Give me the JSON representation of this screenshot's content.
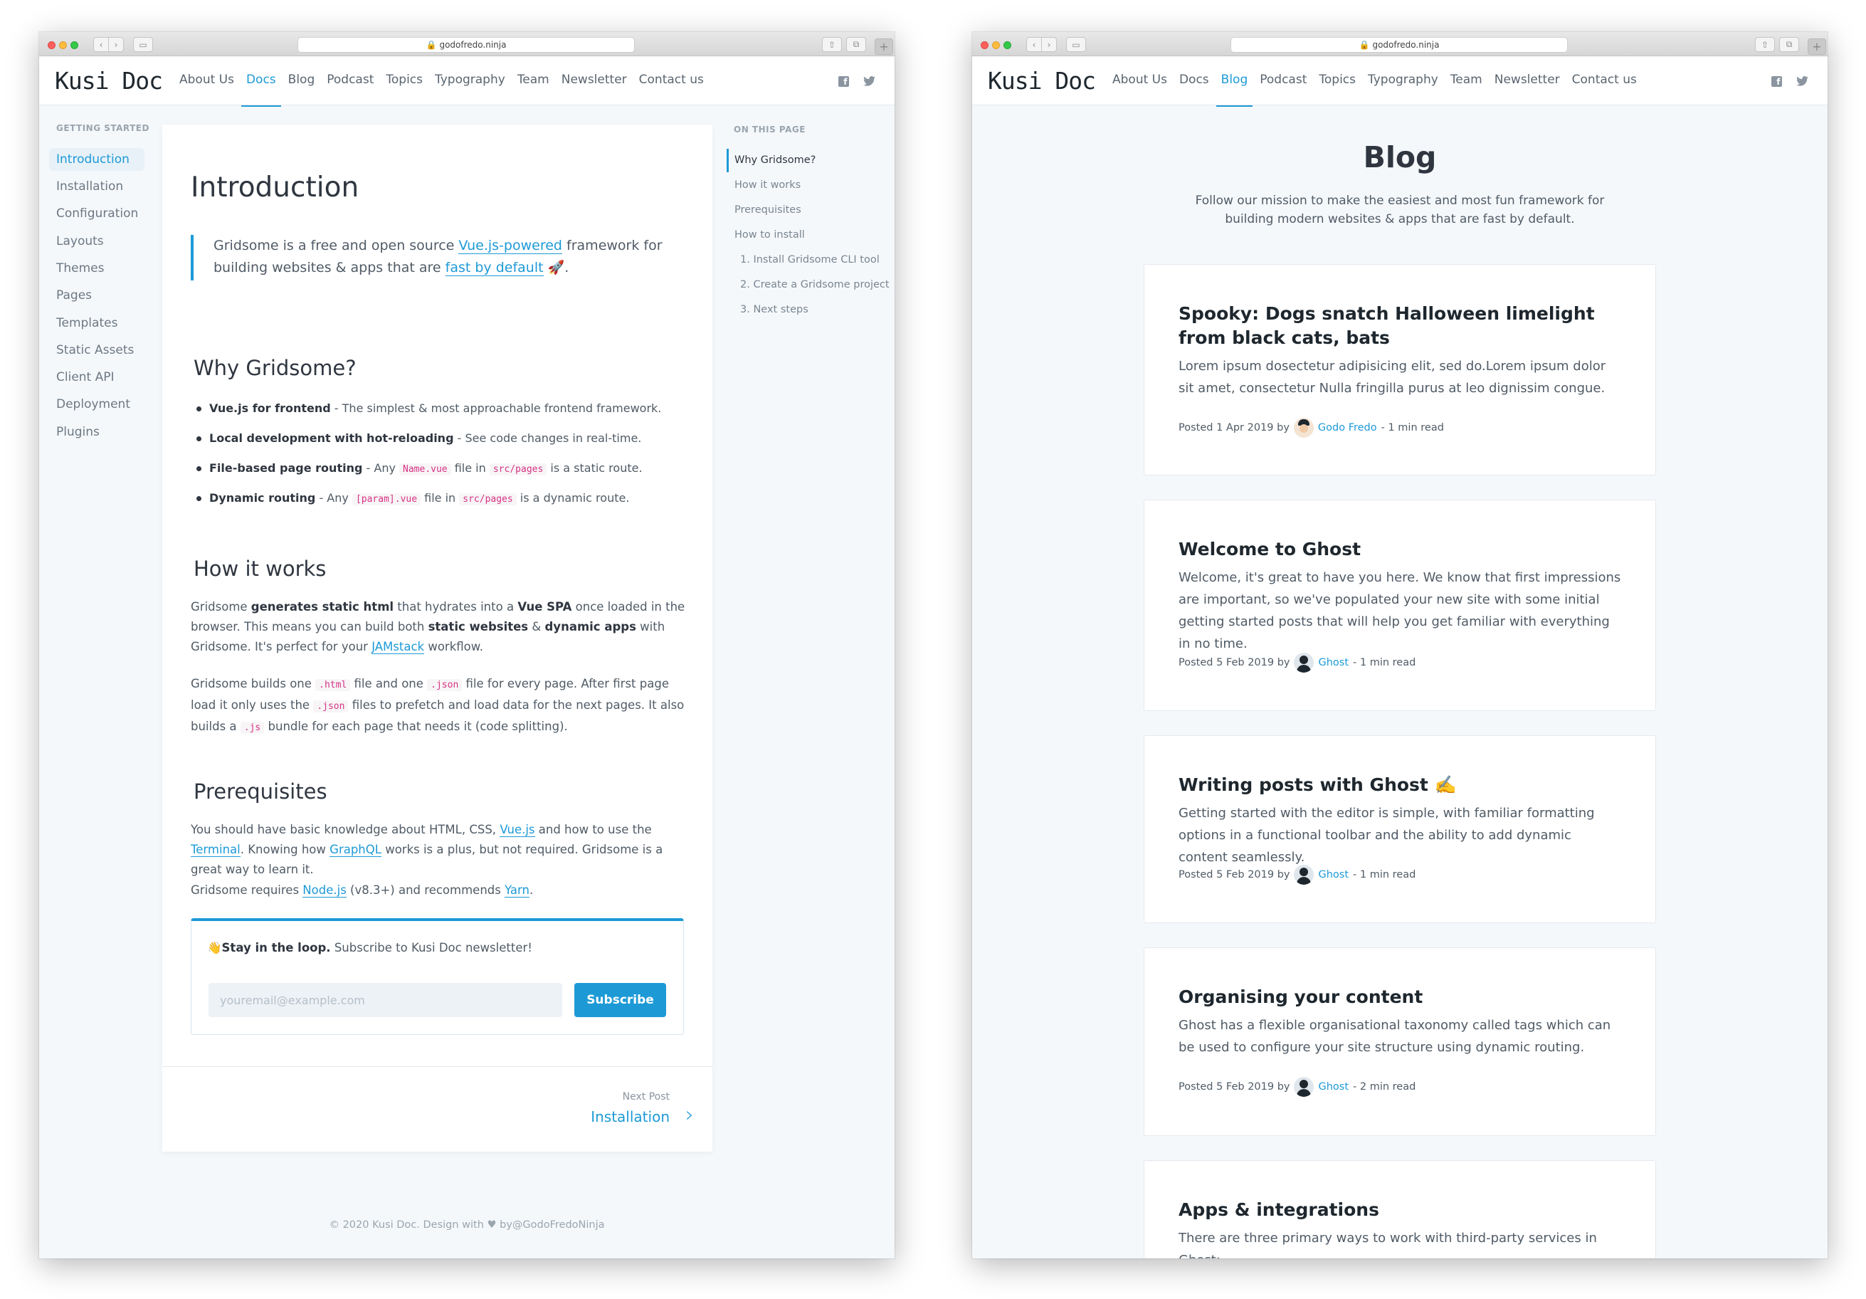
{
  "browser": {
    "url": "godofredo.ninja",
    "plus": "+"
  },
  "site": {
    "logo": "Kusi Doc",
    "nav": [
      "About Us",
      "Docs",
      "Blog",
      "Podcast",
      "Topics",
      "Typography",
      "Team",
      "Newsletter",
      "Contact us"
    ],
    "social_icons": [
      "facebook-icon",
      "twitter-icon"
    ]
  },
  "docs_page": {
    "active_nav": "Docs",
    "sidebar": {
      "heading": "GETTING STARTED",
      "items": [
        "Introduction",
        "Installation",
        "Configuration",
        "Layouts",
        "Themes",
        "Pages",
        "Templates",
        "Static Assets",
        "Client API",
        "Deployment",
        "Plugins"
      ],
      "active": "Introduction"
    },
    "title": "Introduction",
    "lead": {
      "pre": "Gridsome is a free and open source ",
      "link1": "Vue.js-powered",
      "mid": " framework for building websites & apps that are ",
      "link2": "fast by default",
      "post": " 🚀."
    },
    "why_heading": "Why Gridsome?",
    "bullets": [
      {
        "bold": "Vue.js for frontend",
        "text": " - The simplest & most approachable frontend framework."
      },
      {
        "bold": "Local development with hot-reloading",
        "text": " - See code changes in real-time."
      },
      {
        "bold": "File-based page routing",
        "pre": " - Any ",
        "code1": "Name.vue",
        "mid": " file in ",
        "code2": "src/pages",
        "post": " is a static route."
      },
      {
        "bold": "Dynamic routing",
        "pre": " - Any ",
        "code1": "[param].vue",
        "mid": " file in ",
        "code2": "src/pages",
        "post": " is a dynamic route."
      }
    ],
    "how_heading": "How it works",
    "how_p1": {
      "a": "Gridsome ",
      "b1": "generates static html",
      "c": " that hydrates into a ",
      "b2": "Vue SPA",
      "d": " once loaded in the browser. This means you can build both ",
      "b3": "static websites",
      "e": " & ",
      "b4": "dynamic apps",
      "f": " with Gridsome. It's perfect for your ",
      "link": "JAMstack",
      "g": " workflow."
    },
    "how_p2": {
      "a": "Gridsome builds one ",
      "c1": ".html",
      "b": " file and one ",
      "c2": ".json",
      "c": " file for every page. After first page load it only uses the ",
      "c3": ".json",
      "d": " files to prefetch and load data for the next pages. It also builds a ",
      "c4": ".js",
      "e": " bundle for each page that needs it (code splitting)."
    },
    "prereq_heading": "Prerequisites",
    "prereq_p1": {
      "a": "You should have basic knowledge about HTML, CSS, ",
      "l1": "Vue.js",
      "b": " and how to use the ",
      "l2": "Terminal",
      "c": ". Knowing how ",
      "l3": "GraphQL",
      "d": " works is a plus, but not required. Gridsome is a great way to learn it."
    },
    "prereq_p2": {
      "a": "Gridsome requires ",
      "l1": "Node.js",
      "b": " (v8.3+) and recommends ",
      "l2": "Yarn",
      "c": "."
    },
    "subscribe": {
      "emoji": "👋",
      "bold": "Stay in the loop.",
      "text": " Subscribe to Kusi Doc newsletter!",
      "placeholder": "youremail@example.com",
      "button": "Subscribe"
    },
    "next": {
      "label": "Next Post",
      "title": "Installation",
      "arrow": "›"
    },
    "toc": {
      "heading": "ON THIS PAGE",
      "items": [
        "Why Gridsome?",
        "How it works",
        "Prerequisites",
        "How to install",
        "1. Install Gridsome CLI tool",
        "2. Create a Gridsome project",
        "3. Next steps"
      ],
      "active": "Why Gridsome?"
    },
    "footer": "© 2020 Kusi Doc. Design with ♥ by@GodoFredoNinja"
  },
  "blog_page": {
    "active_nav": "Blog",
    "title": "Blog",
    "subtitle": "Follow our mission to make the easiest and most fun framework for building modern websites & apps that are fast by default.",
    "posts": [
      {
        "title": "Spooky: Dogs snatch Halloween limelight from black cats, bats",
        "excerpt": "Lorem ipsum dosectetur adipisicing elit, sed do.Lorem ipsum dolor sit amet, consectetur Nulla fringilla purus at leo dignissim congue.",
        "date": "Posted 1 Apr 2019 by",
        "author": "Godo Fredo",
        "read": "- 1 min read"
      },
      {
        "title": "Welcome to Ghost",
        "excerpt": "Welcome, it's great to have you here. We know that first impressions are important, so we've populated your new site with some initial getting started posts that will help you get familiar with everything in no time.",
        "date": "Posted 5 Feb 2019 by",
        "author": "Ghost",
        "read": "- 1 min read"
      },
      {
        "title": "Writing posts with Ghost ✍️",
        "excerpt": "Getting started with the editor is simple, with familiar formatting options in a functional toolbar and the ability to add dynamic content seamlessly.",
        "date": "Posted 5 Feb 2019 by",
        "author": "Ghost",
        "read": "- 1 min read"
      },
      {
        "title": "Organising your content",
        "excerpt": "Ghost has a flexible organisational taxonomy called tags which can be used to configure your site structure using dynamic routing.",
        "date": "Posted 5 Feb 2019 by",
        "author": "Ghost",
        "read": "- 2 min read"
      },
      {
        "title": "Apps & integrations",
        "excerpt": "There are three primary ways to work with third-party services in Ghost:",
        "date": "",
        "author": "",
        "read": ""
      }
    ]
  },
  "colors": {
    "accent": "#1d9ad6",
    "page_bg": "#f5f8fb",
    "text": "#2f3640"
  }
}
